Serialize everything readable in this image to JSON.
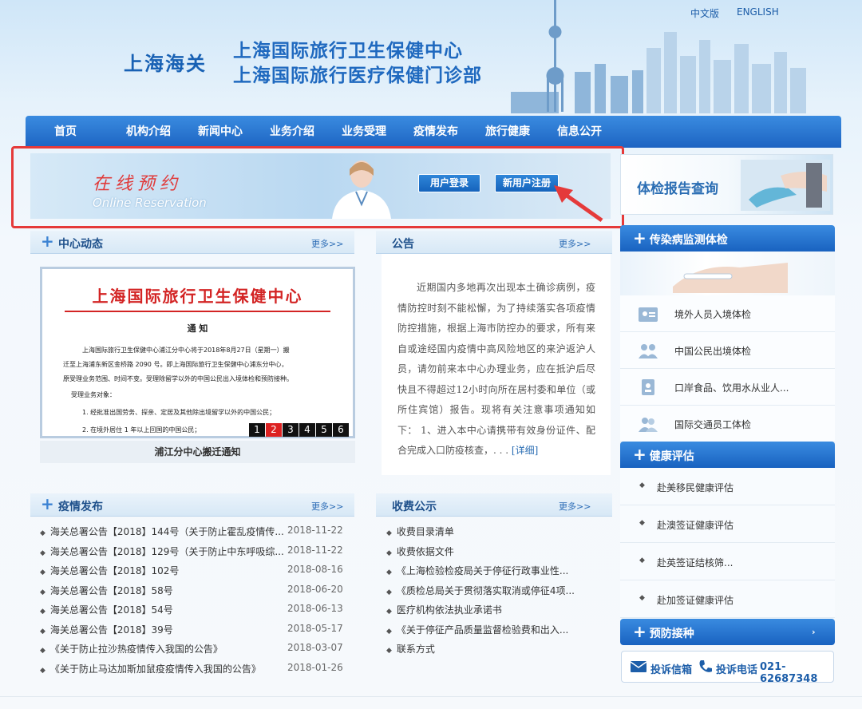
{
  "header": {
    "lang_cn": "中文版",
    "lang_en": "ENGLISH",
    "logo": "上海海关",
    "title_line1": "上海国际旅行卫生保健中心",
    "title_line2": "上海国际旅行医疗保健门诊部"
  },
  "nav": {
    "items": [
      "首页",
      "机构介绍",
      "新闻中心",
      "业务介绍",
      "业务受理",
      "疫情发布",
      "旅行健康",
      "信息公开"
    ]
  },
  "reservation": {
    "title": "在线预约",
    "subtitle": "Online Reservation",
    "login_label": "用户登录",
    "register_label": "新用户注册"
  },
  "report": {
    "label": "体检报告查询"
  },
  "news": {
    "title": "中心动态",
    "more": "更多>>",
    "doc_title": "上海国际旅行卫生保健中心",
    "doc_notice": "通 知",
    "doc_lines": [
      "上海国际旅行卫生保健中心浦江分中心将于2018年8月27日（星期一）搬",
      "迁至上海浦东新区金桥路 2090 号。即上海国际旅行卫生保健中心浦东分中心，",
      "原受理业务范围、时间不变。受理除留学以外的中国公民出入境体检和预防接种。",
      "受理业务对象：",
      "1. 经批准出国劳务、探亲、定居及其他除出境留学以外的中国公民；",
      "2. 在境外居住 1 年以上回国的中国公民；"
    ],
    "pages": [
      "1",
      "2",
      "3",
      "4",
      "5",
      "6"
    ],
    "caption": "浦江分中心搬迁通知"
  },
  "announcement": {
    "title": "公告",
    "more": "更多>>",
    "text": "近期国内多地再次出现本土确诊病例，疫情防控时刻不能松懈，为了持续落实各项疫情防控措施，根据上海市防控办的要求，所有来自或途经国内疫情中高风险地区的来沪返沪人员，请勿前来本中心办理业务，应在抵沪后尽快且不得超过12小时向所在居村委和单位（或所住宾馆）报告。现将有关注意事项通知如下：  1、进入本中心请携带有效身份证件、配合完成入口防疫核查，. . .",
    "detail": "[详细]"
  },
  "epidemic": {
    "title": "疫情发布",
    "more": "更多>>",
    "rows": [
      {
        "text": "海关总署公告【2018】144号（关于防止霍乱疫情传...",
        "date": "2018-11-22"
      },
      {
        "text": "海关总署公告【2018】129号（关于防止中东呼吸综...",
        "date": "2018-11-22"
      },
      {
        "text": "海关总署公告【2018】102号",
        "date": "2018-08-16"
      },
      {
        "text": "海关总署公告【2018】58号",
        "date": "2018-06-20"
      },
      {
        "text": "海关总署公告【2018】54号",
        "date": "2018-06-13"
      },
      {
        "text": "海关总署公告【2018】39号",
        "date": "2018-05-17"
      },
      {
        "text": "《关于防止拉沙热疫情传入我国的公告》",
        "date": "2018-03-07"
      },
      {
        "text": "《关于防止马达加斯加鼠疫疫情传入我国的公告》",
        "date": "2018-01-26"
      }
    ]
  },
  "fees": {
    "title": "收费公示",
    "more": "更多>>",
    "rows": [
      "收费目录清单",
      "收费依据文件",
      "《上海检验检疫局关于停征行政事业性...",
      "《质检总局关于贯彻落实取消或停征4项...",
      "医疗机构依法执业承诺书",
      "《关于停征产品质量监督检验费和出入...",
      "联系方式"
    ]
  },
  "infectious": {
    "title": "传染病监测体检",
    "items": [
      "境外人员入境体检",
      "中国公民出境体检",
      "口岸食品、饮用水从业人...",
      "国际交通员工体检"
    ]
  },
  "health": {
    "title": "健康评估",
    "items": [
      "赴美移民健康评估",
      "赴澳签证健康评估",
      "赴英签证结核筛...",
      "赴加签证健康评估"
    ]
  },
  "vaccination": {
    "title": "预防接种"
  },
  "contact": {
    "mail_label": "投诉信箱",
    "phone_label": "投诉电话",
    "phone_number": "021-62687348"
  }
}
